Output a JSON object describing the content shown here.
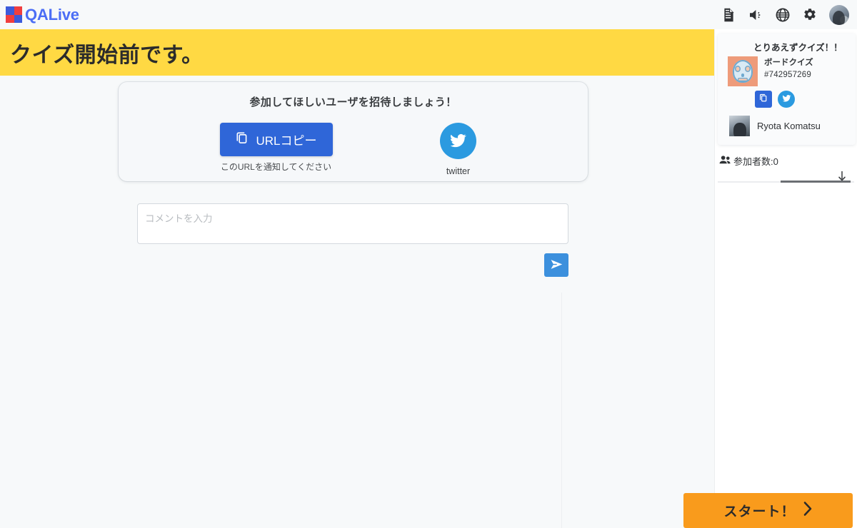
{
  "app": {
    "brand_name": "QALive",
    "logo_icon": "checker-logo-icon"
  },
  "topbar": {
    "icons": [
      {
        "name": "document-icon",
        "label": "document"
      },
      {
        "name": "volume-icon",
        "label": "volume"
      },
      {
        "name": "globe-icon",
        "label": "language"
      },
      {
        "name": "gear-icon",
        "label": "settings"
      }
    ],
    "avatar_label": "user-avatar"
  },
  "banner": {
    "title": "クイズ開始前です。",
    "background": "#ffd943"
  },
  "invite": {
    "heading": "参加してほしいユーザを招待しましょう！",
    "copy_button_label": "URLコピー",
    "copy_icon": "copy-icon",
    "copy_note": "このURLを通知してください",
    "twitter_label": "twitter",
    "twitter_icon": "twitter-icon"
  },
  "comment": {
    "placeholder": "コメントを入力",
    "value": "",
    "send_icon": "send-icon"
  },
  "sidebar": {
    "quiz": {
      "title": "とりあえずクイズ！！",
      "type": "ボードクイズ",
      "id": "#742957269",
      "thumbnail_name": "quiz-thumbnail-skull",
      "copy_icon": "copy-icon",
      "twitter_icon": "twitter-icon"
    },
    "host": {
      "name": "Ryota Komatsu",
      "avatar_label": "host-avatar"
    },
    "participants": {
      "icon": "people-icon",
      "label": "参加者数:0"
    },
    "scroll": {
      "arrow_icon": "arrow-down-icon"
    }
  },
  "footer": {
    "start_label": "スタート！",
    "start_icon": "chevron-right-icon",
    "start_color": "#f99b1c"
  }
}
